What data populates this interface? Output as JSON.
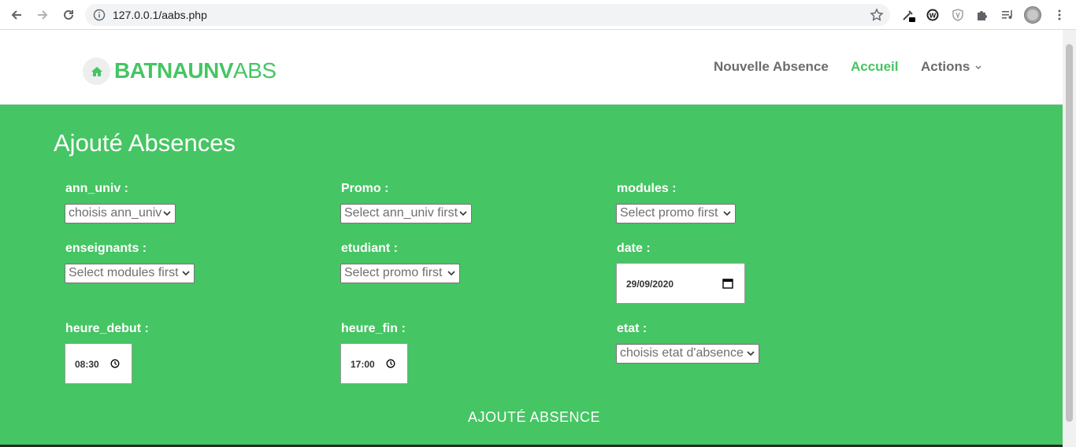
{
  "browser": {
    "url": "127.0.0.1/aabs.php"
  },
  "site": {
    "logo_bold": "BATNAUNV",
    "logo_light": "ABS",
    "nav": {
      "nouvelle": "Nouvelle Absence",
      "accueil": "Accueil",
      "actions": "Actions"
    }
  },
  "form": {
    "title": "Ajouté Absences",
    "fields": {
      "ann_univ": {
        "label": "ann_univ :",
        "value": "choisis ann_univ"
      },
      "promo": {
        "label": "Promo :",
        "value": "Select ann_univ first"
      },
      "modules": {
        "label": "modules :",
        "value": "Select promo first"
      },
      "enseignants": {
        "label": "enseignants :",
        "value": "Select modules first"
      },
      "etudiant": {
        "label": "etudiant :",
        "value": "Select promo first"
      },
      "date": {
        "label": "date :",
        "value": "29/09/2020"
      },
      "heure_debut": {
        "label": "heure_debut :",
        "value": "08:30"
      },
      "heure_fin": {
        "label": "heure_fin :",
        "value": "17:00"
      },
      "etat": {
        "label": "etat :",
        "value": "choisis etat d'absence"
      }
    },
    "submit": "AJOUTÉ ABSENCE"
  },
  "colors": {
    "brand": "#45c563",
    "text_gray": "#6c6c6c"
  }
}
